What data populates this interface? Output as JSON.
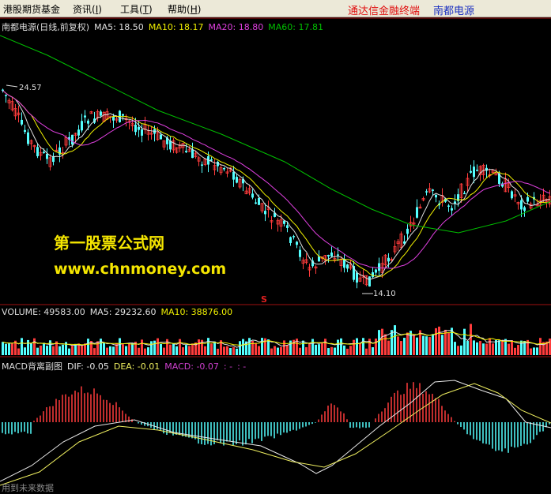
{
  "menubar": {
    "items": [
      {
        "label": "港股期货基金"
      },
      {
        "label": "资讯(",
        "key": "I",
        "tail": ")"
      },
      {
        "label": "工具(",
        "key": "T",
        "tail": ")"
      },
      {
        "label": "帮助(",
        "key": "H",
        "tail": ")"
      }
    ],
    "brand_red": "通达信金融终端",
    "brand_blue": "南都电源"
  },
  "price_legend": {
    "title": "南都电源(日线,前复权)",
    "ma5": "MA5: 18.50",
    "ma10": "MA10: 18.17",
    "ma20": "MA20: 18.80",
    "ma60": "MA60: 17.81"
  },
  "volume_legend": {
    "volume": "VOLUME: 49583.00",
    "ma5": "MA5: 29232.60",
    "ma10": "MA10: 38876.00"
  },
  "macd_legend": {
    "title": "MACD背离副图",
    "dif": "DIF: -0.05",
    "dea": "DEA: -0.01",
    "macd": "MACD: -0.07",
    "extra1": ":  -",
    "extra2": ":  -"
  },
  "annotations": {
    "high": "24.57",
    "low": "14.10",
    "signal": "S"
  },
  "watermark": {
    "title": "第一股票公式网",
    "url": "www.chnmoney.com"
  },
  "footer": "用到未来数据",
  "colors": {
    "up": "#ff3c3c",
    "down": "#54ffff",
    "ma5": "#e0e0e0",
    "ma10": "#f0f000",
    "ma20": "#e040e0",
    "ma60": "#00c000",
    "dif": "#e8e8e8",
    "dea": "#f0f060",
    "macd_purple": "#d040d0"
  },
  "chart_data": {
    "type": "candlestick",
    "price_range": [
      14.1,
      24.57
    ],
    "series": [
      {
        "name": "MA5",
        "value": 18.5
      },
      {
        "name": "MA10",
        "value": 18.17
      },
      {
        "name": "MA20",
        "value": 18.8
      },
      {
        "name": "MA60",
        "value": 17.81
      }
    ],
    "volume": {
      "last": 49583.0,
      "ma5": 29232.6,
      "ma10": 38876.0
    },
    "macd": {
      "dif": -0.05,
      "dea": -0.01,
      "macd": -0.07
    }
  }
}
